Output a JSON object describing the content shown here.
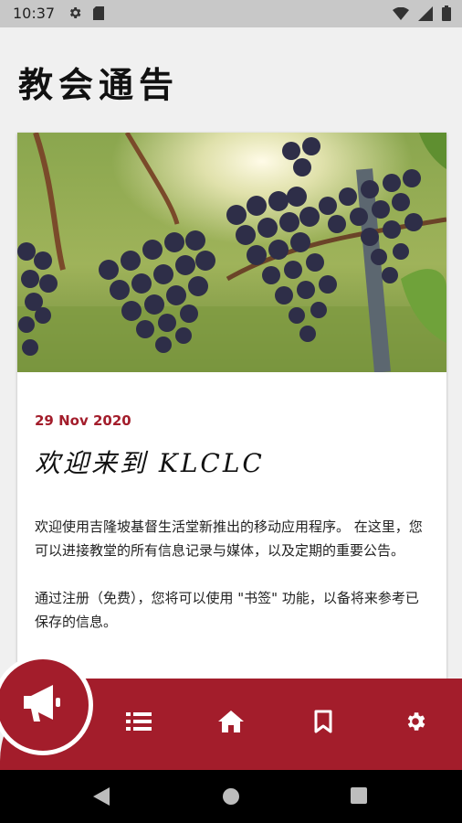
{
  "status_bar": {
    "time": "10:37"
  },
  "header": {
    "title": "教会通告"
  },
  "post": {
    "date": "29 Nov 2020",
    "title": "欢迎来到 KLCLC",
    "paragraphs": [
      "欢迎使用吉隆坡基督生活堂新推出的移动应用程序。 在这里，您可以进接教堂的所有信息记录与媒体，以及定期的重要公告。",
      "通过注册（免费），您将可以使用 \"书签\" 功能，以备将来参考已保存的信息。"
    ]
  },
  "bottom_nav": {
    "items": [
      "announcements-icon",
      "list-icon",
      "home-icon",
      "bookmark-icon",
      "settings-icon"
    ]
  },
  "colors": {
    "accent": "#a31d2b",
    "background": "#f0f0f0"
  }
}
